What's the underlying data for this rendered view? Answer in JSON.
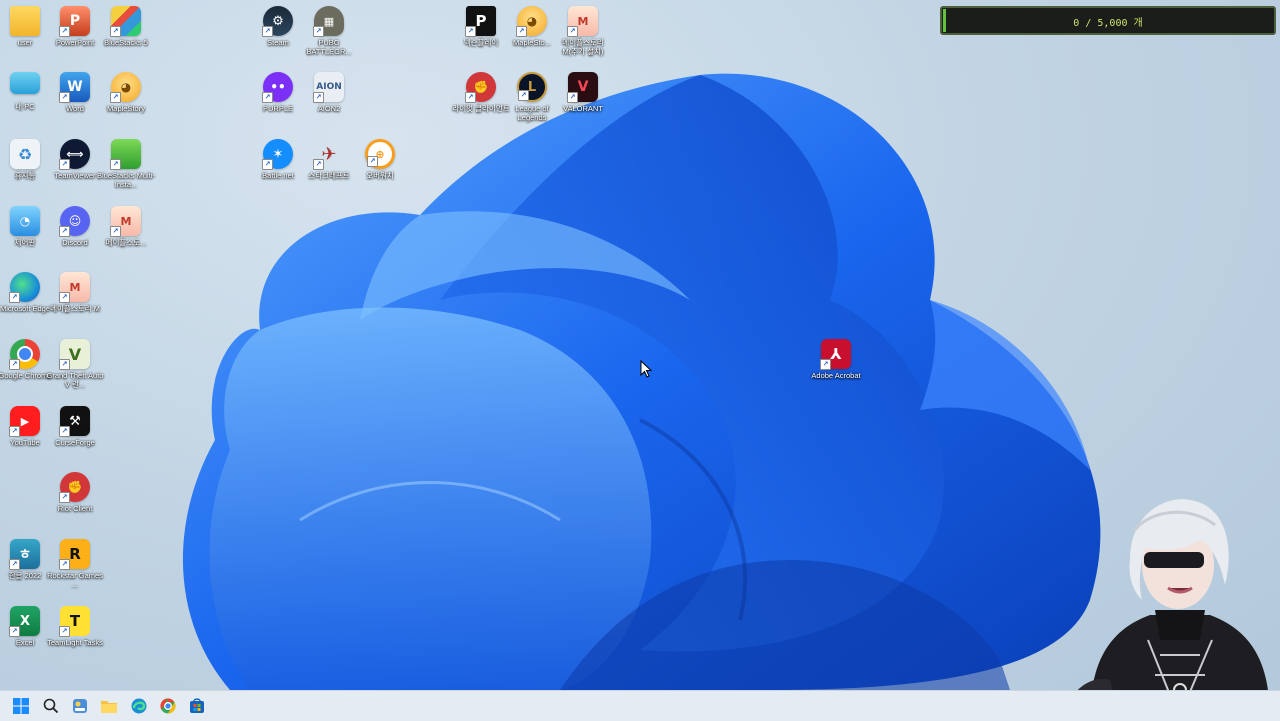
{
  "desktop_icons": {
    "user": "user",
    "powerpoint": "PowerPoint",
    "bluestacks5": "BlueStacks 5",
    "steam": "Steam",
    "pubg": "PUBG BATTLEGR...",
    "nexon_play": "넥슨플레이",
    "maplestory_top": "MapleSto...",
    "maplestory_m_top": "메이플스토리 M(추가 설치)",
    "mypc": "내 PC",
    "word": "Word",
    "maplestory": "MapleStory",
    "purple": "PURPLE",
    "aion2": "AION2",
    "riot_client_top": "라이엇 클라이언트",
    "league": "League of Legends",
    "valorant": "VALORANT",
    "recycle": "휴지통",
    "teamviewer": "TeamViewer",
    "bluestacks_multi": "BlueStacks Multi-Insta...",
    "battlenet": "Battle.net",
    "starcraft": "스타크래프트",
    "overwatch": "오버워치",
    "control_panel": "제어판",
    "discord": "Discord",
    "maplestory_m2": "메이플스토...",
    "edge": "Microsoft Edge",
    "maplestory_m": "메이플스토리 M",
    "acrobat": "Adobe Acrobat",
    "chrome": "Google Chrome",
    "gta5": "Grand Theft Auto V 런...",
    "youtube": "YouTube",
    "curseforge": "CurseForge",
    "riot_client": "Riot Client",
    "hangul2022": "한글 2022",
    "rockstar": "Rockstar Games ...",
    "excel": "Excel",
    "teamlight": "TeamLight Tasks"
  },
  "counter": {
    "text": "0 / 5,000 개",
    "progress": 0.01,
    "fill_color": "#63c23a"
  },
  "taskbar": {
    "items": [
      "start-icon",
      "search-icon",
      "widgets-icon",
      "file-explorer-icon",
      "edge-icon",
      "chrome-icon",
      "store-icon"
    ]
  },
  "colors": {
    "accent": "#0b5ed7",
    "wallpaper_bloom": "#1f6ff2",
    "taskbar": "#e4ebf2"
  }
}
